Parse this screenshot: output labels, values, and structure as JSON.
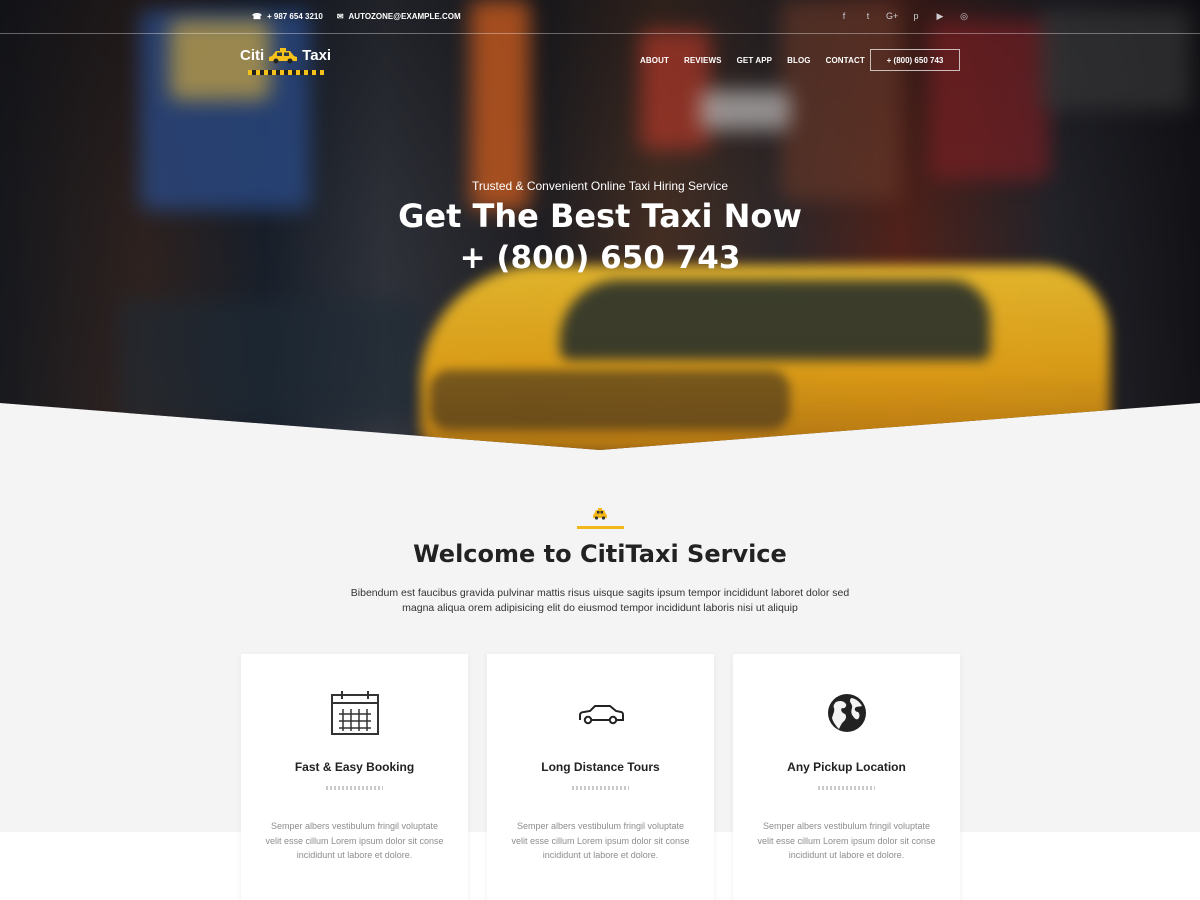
{
  "topbar": {
    "phone": "+ 987 654 3210",
    "email": "AUTOZONE@EXAMPLE.COM",
    "social_icons": [
      "facebook-icon",
      "twitter-icon",
      "google-plus-icon",
      "pinterest-icon",
      "youtube-icon",
      "instagram-icon"
    ],
    "social_glyphs": [
      "f",
      "t",
      "G+",
      "p",
      "▶",
      "◎"
    ]
  },
  "header": {
    "logo_left": "Citi",
    "logo_right": "Taxi",
    "nav": [
      "ABOUT",
      "REVIEWS",
      "GET APP",
      "BLOG",
      "CONTACT"
    ],
    "phone_button": "+ (800) 650 743"
  },
  "hero": {
    "subtitle": "Trusted & Convenient Online Taxi Hiring Service",
    "title": "Get The Best Taxi Now",
    "phone": "+ (800) 650 743"
  },
  "welcome": {
    "title": "Welcome to CitiTaxi Service",
    "text_line1": "Bibendum est faucibus gravida pulvinar mattis risus uisque sagits ipsum tempor incididunt laboret dolor sed",
    "text_line2": "magna aliqua orem adipisicing elit do eiusmod tempor incididunt laboris nisi ut aliquip"
  },
  "features": [
    {
      "icon": "calendar-icon",
      "title": "Fast & Easy Booking",
      "text1": "Semper albers vestibulum fringil voluptate",
      "text2": "velit esse cillum Lorem ipsum dolor sit conse",
      "text3": "incididunt ut labore et dolore."
    },
    {
      "icon": "car-icon",
      "title": "Long Distance Tours",
      "text1": "Semper albers vestibulum fringil voluptate",
      "text2": "velit esse cillum Lorem ipsum dolor sit conse",
      "text3": "incididunt ut labore et dolore."
    },
    {
      "icon": "globe-icon",
      "title": "Any Pickup Location",
      "text1": "Semper albers vestibulum fringil voluptate",
      "text2": "velit esse cillum Lorem ipsum dolor sit conse",
      "text3": "incididunt ut labore et dolore."
    }
  ],
  "colors": {
    "accent_yellow": "#f2b81b",
    "page_bg": "#f4f4f5",
    "dark_text": "#222222"
  }
}
